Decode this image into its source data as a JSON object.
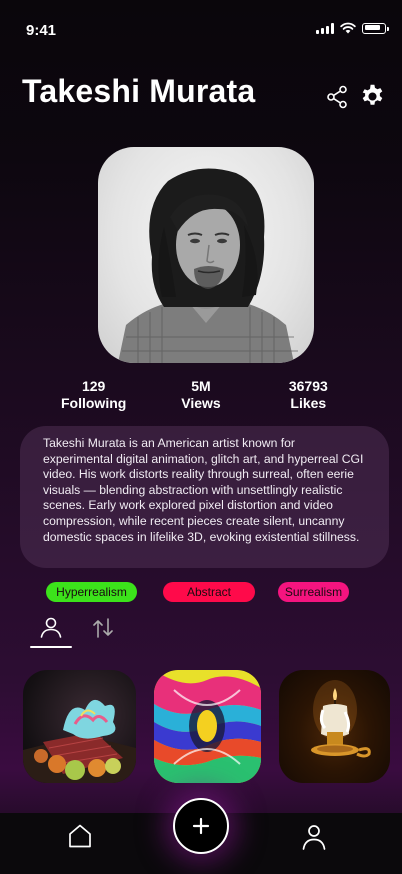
{
  "status_bar": {
    "time": "9:41"
  },
  "profile": {
    "name": "Takeshi Murata",
    "stats": [
      {
        "value": "129",
        "label": "Following"
      },
      {
        "value": "5M",
        "label": "Views"
      },
      {
        "value": "36793",
        "label": "Likes"
      }
    ],
    "bio": "Takeshi Murata is an American artist known for experimental digital animation, glitch art, and hyperreal CGI video. His work distorts reality through surreal, often eerie visuals — blending abstraction with unsettlingly realistic scenes. Early work explored pixel distortion and video compression, while recent pieces create silent, uncanny domestic spaces in lifelike 3D, evoking existential stillness.",
    "tags": [
      {
        "label": "Hyperrealism",
        "color": "#3ce21b"
      },
      {
        "label": "Abstract",
        "color": "#ff0a4a"
      },
      {
        "label": "Surrealism",
        "color": "#f5147f"
      }
    ]
  },
  "header_icons": [
    "share-icon",
    "settings-icon"
  ],
  "tabs": [
    "user-icon",
    "repost-icon"
  ],
  "posts_count_visible": 3,
  "nav": [
    "home-icon",
    "add-icon",
    "profile-icon"
  ],
  "colors": {
    "accent_glow": "#7a1482",
    "background_top": "#0a060b",
    "background_bottom": "#3a0c40"
  }
}
